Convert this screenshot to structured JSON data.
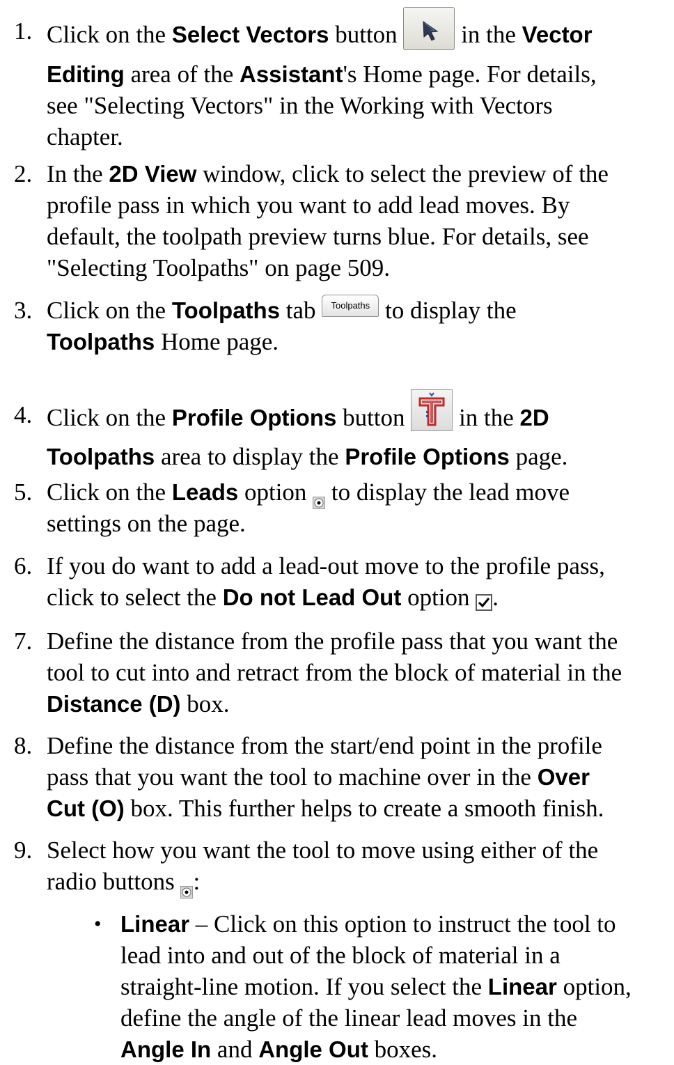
{
  "steps": [
    {
      "num": "1.",
      "t1": "Click on the ",
      "b1": "Select Vectors",
      "t2": " button ",
      "t3": " in the ",
      "b2": "Vector",
      "b3": "Editing",
      "t4": " area of the ",
      "b4": "Assistant",
      "t5": "'s Home page. For details,",
      "l3": "see \"Selecting Vectors\" in the Working with Vectors",
      "l4": "chapter."
    },
    {
      "num": "2.",
      "t1": "In the ",
      "b1": "2D View",
      "t2": " window, click to select the preview of the",
      "l2": "profile pass in which you want to add lead moves. By",
      "l3": "default, the toolpath preview turns blue. For details, see",
      "l4": "\"Selecting Toolpaths\" on page 509."
    },
    {
      "num": "3.",
      "t1": "Click on the ",
      "b1": "Toolpaths",
      "t2": " tab ",
      "icon_label": "Toolpaths",
      "t3": " to display the",
      "b2": "Toolpaths",
      "t4": " Home page."
    },
    {
      "num": "4.",
      "t1": "Click on the ",
      "b1": "Profile Options",
      "t2": " button ",
      "t3": " in the ",
      "b2": "2D",
      "b3": "Toolpaths",
      "t4": " area to display the ",
      "b4": "Profile Options",
      "t5": " page."
    },
    {
      "num": "5.",
      "t1": "Click on the ",
      "b1": "Leads",
      "t2": " option ",
      "t3": " to display the lead move",
      "l2": "settings on the page."
    },
    {
      "num": "6.",
      "l1": "If you do want to add a lead-out move to the profile pass,",
      "t1": "click to select the ",
      "b1": "Do not Lead Out",
      "t2": " option ",
      "t3": "."
    },
    {
      "num": "7.",
      "l1": "Define the distance from the profile pass that you want the",
      "l2": "tool to cut into and retract from the block of material in the",
      "b1": "Distance (D)",
      "t1": " box."
    },
    {
      "num": "8.",
      "l1": "Define the distance from the start/end point in the profile",
      "t1": "pass that you want the tool to machine over in the ",
      "b1": "Over",
      "b2": "Cut (O)",
      "t2": " box. This further helps to create a smooth finish."
    },
    {
      "num": "9.",
      "l1": "Select how you want the tool to move using either of the",
      "t1": "radio buttons ",
      "t2": ":"
    }
  ],
  "bullet": {
    "b1": "Linear",
    "t1": " – Click on this option to instruct the tool to",
    "l2": "lead into and out of the block of material in a",
    "t2": "straight-line motion. If you select the ",
    "b2": "Linear",
    "t3": " option,",
    "l4": "define the angle of the linear lead moves in the",
    "b3": "Angle In",
    "t4": " and ",
    "b4": "Angle Out",
    "t5": " boxes."
  },
  "icons": {
    "select_vectors": "select-arrow-icon",
    "toolpaths_tab": "toolpaths-tab-icon",
    "profile_options": "profile-options-icon",
    "radio": "radio-selected-icon",
    "checkbox": "checkbox-checked-icon"
  }
}
